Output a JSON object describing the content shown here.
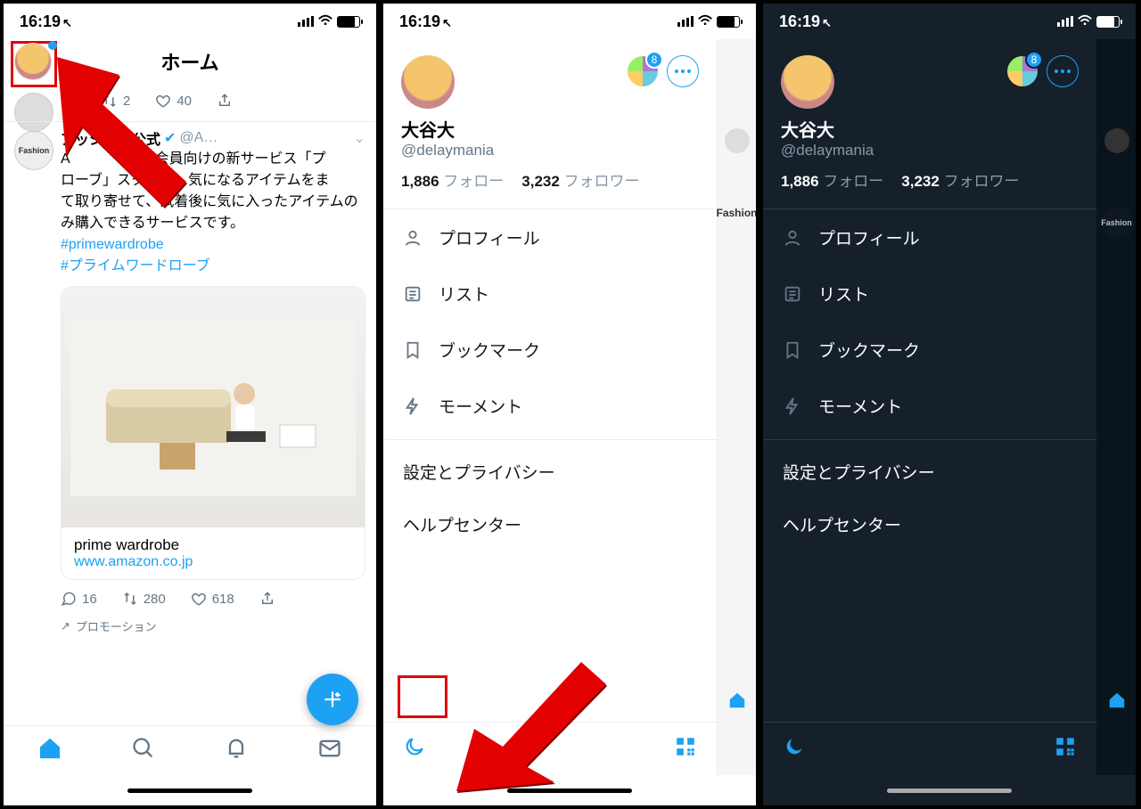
{
  "status": {
    "time": "16:19",
    "battery": "78%"
  },
  "screen1": {
    "title": "ホーム",
    "tweet0": {
      "retweets": "2",
      "likes": "40"
    },
    "tweet1": {
      "author": "アッション公式",
      "verified": true,
      "handle": "@A…",
      "body_pre": "A　　　　イム会員向けの新サービス「プ　　　　　ローブ」スタート！気になるアイテムをま　　て取り寄せて、試着後に気に入ったアイテムのみ購入できるサービスです。",
      "hashtag1": "#primewardrobe",
      "hashtag2": "#プライムワードローブ",
      "avatar_label": "Fashion",
      "card_title": "prime wardrobe",
      "card_url": "www.amazon.co.jp",
      "replies": "16",
      "retweets": "280",
      "likes": "618",
      "promo": "プロモーション"
    }
  },
  "drawer": {
    "account_badge": "8",
    "name": "大谷大",
    "handle": "@delaymania",
    "following_count": "1,886",
    "following_label": "フォロー",
    "followers_count": "3,232",
    "followers_label": "フォロワー",
    "item_profile": "プロフィール",
    "item_list": "リスト",
    "item_bookmark": "ブックマーク",
    "item_moments": "モーメント",
    "item_settings": "設定とプライバシー",
    "item_help": "ヘルプセンター"
  },
  "sidestrip": {
    "fashion": "Fashion"
  }
}
